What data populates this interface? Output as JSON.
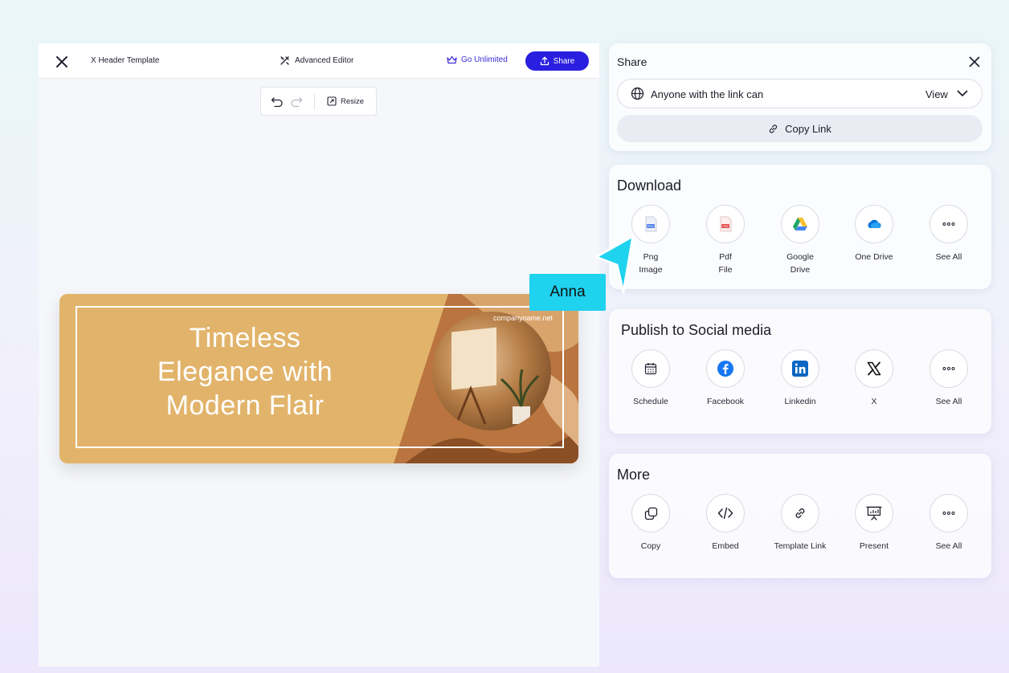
{
  "editor": {
    "doc_title": "X Header Template",
    "advanced_editor_label": "Advanced Editor",
    "go_unlimited_label": "Go Unlimited",
    "share_button_label": "Share",
    "toolbar": {
      "resize_label": "Resize"
    }
  },
  "banner": {
    "headline": "Timeless Elegance with Modern Flair",
    "url": "companyname.net",
    "colors": {
      "gold": "#e2b46b",
      "brown": "#b9743f"
    }
  },
  "share_panel": {
    "title": "Share",
    "link_access_label": "Anyone with the link can",
    "permission_value": "View",
    "copy_link_label": "Copy Link"
  },
  "download": {
    "title": "Download",
    "options": [
      {
        "label": "Png\nImage",
        "icon": "png-file-icon"
      },
      {
        "label": "Pdf\nFile",
        "icon": "pdf-file-icon"
      },
      {
        "label": "Google\nDrive",
        "icon": "google-drive-icon"
      },
      {
        "label": "One Drive",
        "icon": "onedrive-icon"
      },
      {
        "label": "See All",
        "icon": "more-dots-icon"
      }
    ]
  },
  "social": {
    "title": "Publish to Social media",
    "options": [
      {
        "label": "Schedule",
        "icon": "calendar-icon"
      },
      {
        "label": "Facebook",
        "icon": "facebook-icon"
      },
      {
        "label": "Linkedin",
        "icon": "linkedin-icon"
      },
      {
        "label": "X",
        "icon": "x-logo-icon"
      },
      {
        "label": "See All",
        "icon": "more-dots-icon"
      }
    ]
  },
  "more": {
    "title": "More",
    "options": [
      {
        "label": "Copy",
        "icon": "copy-icon"
      },
      {
        "label": "Embed",
        "icon": "embed-code-icon"
      },
      {
        "label": "Template Link",
        "icon": "link-icon"
      },
      {
        "label": "Present",
        "icon": "presentation-icon"
      },
      {
        "label": "See All",
        "icon": "more-dots-icon"
      }
    ]
  },
  "collaborator": {
    "name": "Anna",
    "color": "#1fd2ee"
  },
  "colors": {
    "accent": "#2a1fe0",
    "accent_text": "#3b2bd6"
  }
}
